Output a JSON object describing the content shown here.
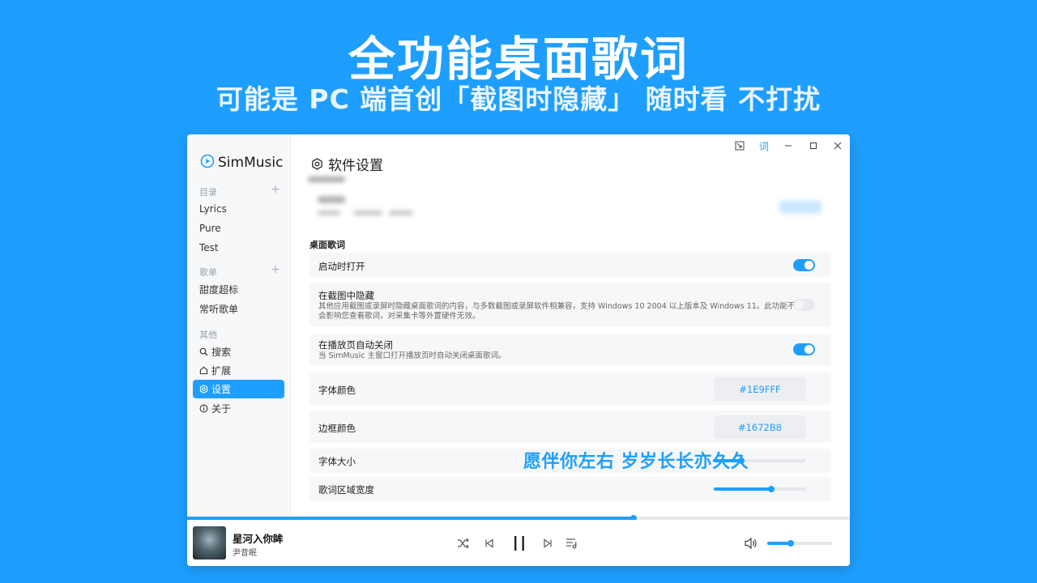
{
  "hero": {
    "title": "全功能桌面歌词",
    "subtitle": "可能是 PC 端首创「截图时隐藏」 随时看 不打扰"
  },
  "app": {
    "name": "SimMusic",
    "accent": "#1E9FFF"
  },
  "titlebar": {
    "lyrics_button": "词"
  },
  "sidebar": {
    "sections": [
      {
        "label": "目录",
        "items": [
          "Lyrics",
          "Pure",
          "Test"
        ]
      },
      {
        "label": "歌单",
        "items": [
          "甜度超标",
          "常听歌单"
        ]
      },
      {
        "label": "其他",
        "items": [
          "搜索",
          "扩展",
          "设置",
          "关于"
        ]
      }
    ],
    "active_item": "设置"
  },
  "settings": {
    "page_title": "软件设置",
    "group_title": "桌面歌词",
    "rows": [
      {
        "title": "启动时打开",
        "type": "toggle",
        "enabled": true
      },
      {
        "title": "在截图中隐藏",
        "desc": "其他应用截图或录屏时隐藏桌面歌词的内容，与多数截图或录屏软件相兼容，支持 Windows 10 2004 以上版本及 Windows 11。此功能不会影响您查看歌词，对采集卡等外置硬件无效。",
        "type": "toggle",
        "enabled": false
      },
      {
        "title": "在播放页自动关闭",
        "desc": "当 SimMusic 主窗口打开播放页时自动关闭桌面歌词。",
        "type": "toggle",
        "enabled": true
      },
      {
        "title": "字体颜色",
        "type": "color",
        "value": "#1E9FFF"
      },
      {
        "title": "边框颜色",
        "type": "color",
        "value": "#1672B8"
      },
      {
        "title": "字体大小",
        "type": "slider",
        "value": 0.3
      },
      {
        "title": "歌词区域宽度",
        "type": "slider",
        "value": 0.62
      }
    ],
    "lyric_preview": "愿伴你左右 岁岁长长亦久久"
  },
  "player": {
    "song_title": "星河入你眸",
    "artist": "尹昔眠",
    "progress": 0.673,
    "volume": 0.36
  }
}
